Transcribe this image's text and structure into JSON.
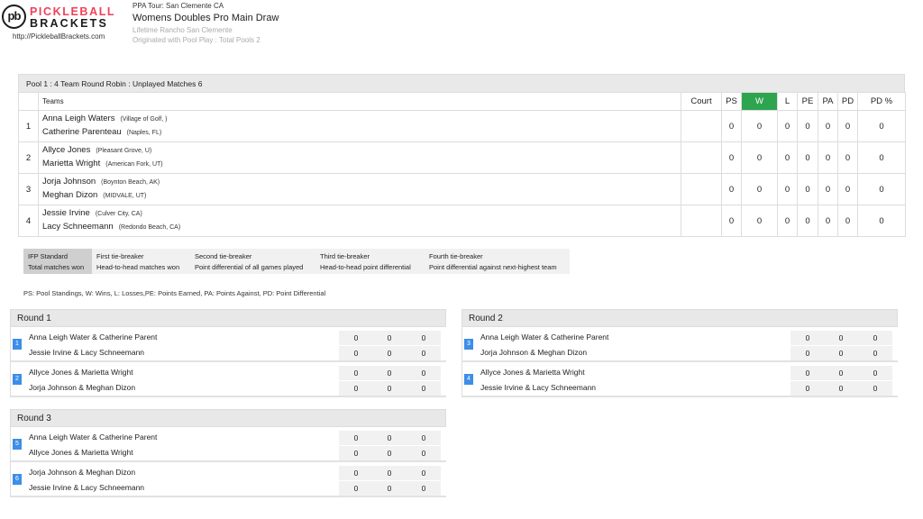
{
  "header": {
    "logo_line1": "PICKLEBALL",
    "logo_line2": "BRACKETS",
    "logo_mark": "pb",
    "site_url": "http://PickleballBrackets.com",
    "tour": "PPA Tour: San Clemente CA",
    "event": "Womens Doubles Pro Main Draw",
    "venue": "Lifetime Rancho San Clemente",
    "origin": "Originated with Pool Play : Total Pools 2"
  },
  "pool": {
    "title": "Pool 1 : 4 Team Round Robin : Unplayed Matches 6",
    "columns": [
      "Teams",
      "Court",
      "PS",
      "W",
      "L",
      "PE",
      "PA",
      "PD",
      "PD %"
    ],
    "rows": [
      {
        "seed": "1",
        "p1": "Anna Leigh Waters",
        "l1": "(Village of Golf, )",
        "p2": "Catherine Parenteau",
        "l2": "(Naples, FL)",
        "court": "",
        "ps": "0",
        "w": "0",
        "l": "0",
        "pe": "0",
        "pa": "0",
        "pd": "0",
        "pdpct": "0"
      },
      {
        "seed": "2",
        "p1": "Allyce Jones",
        "l1": "(Pleasant Grove, U)",
        "p2": "Marietta Wright",
        "l2": "(American Fork, UT)",
        "court": "",
        "ps": "0",
        "w": "0",
        "l": "0",
        "pe": "0",
        "pa": "0",
        "pd": "0",
        "pdpct": "0"
      },
      {
        "seed": "3",
        "p1": "Jorja Johnson",
        "l1": "(Boynton Beach, AK)",
        "p2": "Meghan Dizon",
        "l2": "(MIDVALE, UT)",
        "court": "",
        "ps": "0",
        "w": "0",
        "l": "0",
        "pe": "0",
        "pa": "0",
        "pd": "0",
        "pdpct": "0"
      },
      {
        "seed": "4",
        "p1": "Jessie Irvine",
        "l1": "(Culver City, CA)",
        "p2": "Lacy Schneemann",
        "l2": "(Redondo Beach, CA)",
        "court": "",
        "ps": "0",
        "w": "0",
        "l": "0",
        "pe": "0",
        "pa": "0",
        "pd": "0",
        "pdpct": "0"
      }
    ]
  },
  "tiebreakers": [
    {
      "title": "IFP Standard",
      "desc": "Total matches won"
    },
    {
      "title": "First tie-breaker",
      "desc": "Head-to-head matches won"
    },
    {
      "title": "Second tie-breaker",
      "desc": "Point differential of all games played"
    },
    {
      "title": "Third tie-breaker",
      "desc": "Head-to-head point differential"
    },
    {
      "title": "Fourth tie-breaker",
      "desc": "Point differential against next-highest team"
    }
  ],
  "legend": "PS: Pool Standings, W: Wins, L: Losses,PE: Points Earned, PA: Points Against, PD: Point Differential",
  "rounds": [
    {
      "title": "Round 1",
      "matches": [
        {
          "num": "1",
          "team1": "Anna Leigh Water & Catherine Parent",
          "team2": "Jessie Irvine & Lacy Schneemann",
          "s1": [
            "0",
            "0",
            "0"
          ],
          "s2": [
            "0",
            "0",
            "0"
          ]
        },
        {
          "num": "2",
          "team1": "Allyce Jones & Marietta Wright",
          "team2": "Jorja Johnson & Meghan Dizon",
          "s1": [
            "0",
            "0",
            "0"
          ],
          "s2": [
            "0",
            "0",
            "0"
          ]
        }
      ]
    },
    {
      "title": "Round 2",
      "matches": [
        {
          "num": "3",
          "team1": "Anna Leigh Water & Catherine Parent",
          "team2": "Jorja Johnson & Meghan Dizon",
          "s1": [
            "0",
            "0",
            "0"
          ],
          "s2": [
            "0",
            "0",
            "0"
          ]
        },
        {
          "num": "4",
          "team1": "Allyce Jones & Marietta Wright",
          "team2": "Jessie Irvine & Lacy Schneemann",
          "s1": [
            "0",
            "0",
            "0"
          ],
          "s2": [
            "0",
            "0",
            "0"
          ]
        }
      ]
    },
    {
      "title": "Round 3",
      "matches": [
        {
          "num": "5",
          "team1": "Anna Leigh Water & Catherine Parent",
          "team2": "Allyce Jones & Marietta Wright",
          "s1": [
            "0",
            "0",
            "0"
          ],
          "s2": [
            "0",
            "0",
            "0"
          ]
        },
        {
          "num": "6",
          "team1": "Jorja Johnson & Meghan Dizon",
          "team2": "Jessie Irvine & Lacy Schneemann",
          "s1": [
            "0",
            "0",
            "0"
          ],
          "s2": [
            "0",
            "0",
            "0"
          ]
        }
      ]
    }
  ],
  "colors": {
    "brand_pink": "#f0405a",
    "wins_header": "#2ea44f",
    "match_badge": "#3d8ee8"
  }
}
